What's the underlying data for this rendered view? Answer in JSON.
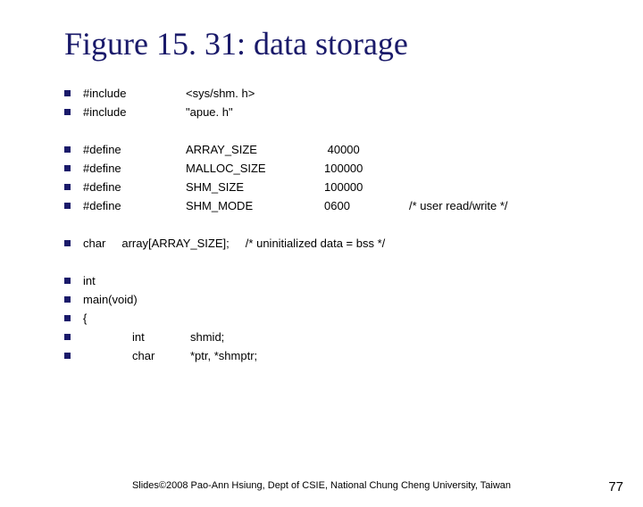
{
  "title": "Figure 15. 31: data storage",
  "rows": [
    {
      "b": true,
      "c0": "#include",
      "c1": "<sys/shm. h>"
    },
    {
      "b": true,
      "c0": "#include",
      "c1": "\"apue. h\""
    },
    {
      "gap": true
    },
    {
      "b": true,
      "c0": "#define",
      "c1": "ARRAY_SIZE",
      "c2": " 40000"
    },
    {
      "b": true,
      "c0": "#define",
      "c1": "MALLOC_SIZE",
      "c2": "100000"
    },
    {
      "b": true,
      "c0": "#define",
      "c1": "SHM_SIZE",
      "c2": "100000"
    },
    {
      "b": true,
      "c0": "#define",
      "c1": "SHM_MODE",
      "c2": "0600",
      "c3": "/* user read/write */"
    },
    {
      "gap": true
    },
    {
      "b": true,
      "full": "char     array[ARRAY_SIZE];     /* uninitialized data = bss */"
    },
    {
      "gap": true
    },
    {
      "b": true,
      "full": "int"
    },
    {
      "b": true,
      "full": "main(void)"
    },
    {
      "b": true,
      "full": "{"
    },
    {
      "b": true,
      "indent": true,
      "c0": "int",
      "c1": "shmid;"
    },
    {
      "b": true,
      "indent": true,
      "c0": "char",
      "c1": "*ptr, *shmptr;"
    }
  ],
  "footer": "Slides©2008 Pao-Ann Hsiung, Dept of CSIE, National Chung Cheng University, Taiwan",
  "page": "77"
}
